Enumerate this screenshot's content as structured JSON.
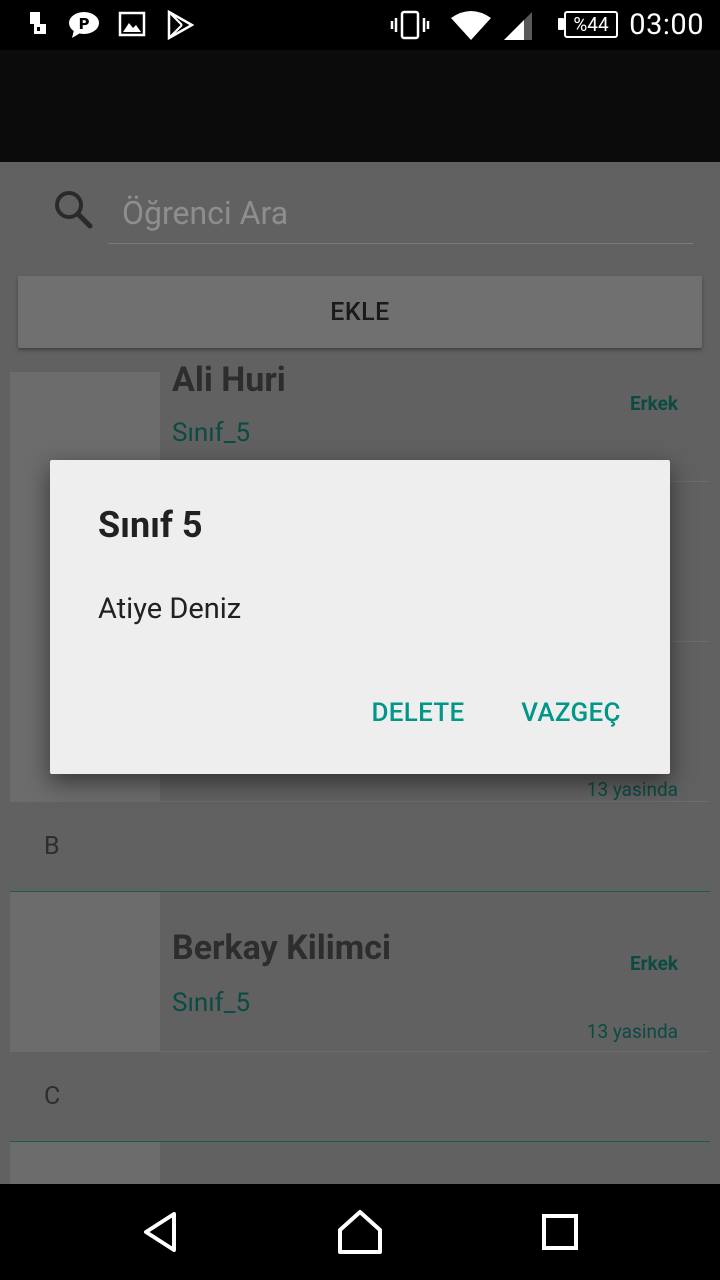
{
  "status_bar": {
    "icons": [
      "usb-debug-icon",
      "chat-icon",
      "image-icon",
      "play-store-icon",
      "vibrate-icon",
      "wifi-icon",
      "signal-icon",
      "battery-icon"
    ],
    "battery": "%44",
    "time": "03:00"
  },
  "search": {
    "placeholder": "Öğrenci Ara"
  },
  "add_button": {
    "label": "EKLE"
  },
  "list": {
    "items_a": [
      {
        "name": "Ali Huri",
        "class": "Sınıf_5",
        "gender": "Erkek",
        "age": ""
      },
      {
        "name": "",
        "class": "",
        "gender": "",
        "age": ""
      },
      {
        "name": "",
        "class": "",
        "gender": "",
        "age": "13 yasinda"
      }
    ],
    "section_b": "B",
    "items_b": [
      {
        "name": "Berkay Kilimci",
        "class": "Sınıf_5",
        "gender": "Erkek",
        "age": "13 yasinda"
      }
    ],
    "section_c": "C"
  },
  "dialog": {
    "title": "Sınıf 5",
    "message": "Atiye Deniz",
    "delete_label": "DELETE",
    "cancel_label": "VAZGEÇ"
  },
  "colors": {
    "accent": "#009688",
    "dim_overlay_bg": "#616161",
    "dialog_bg": "#eeeeee"
  }
}
